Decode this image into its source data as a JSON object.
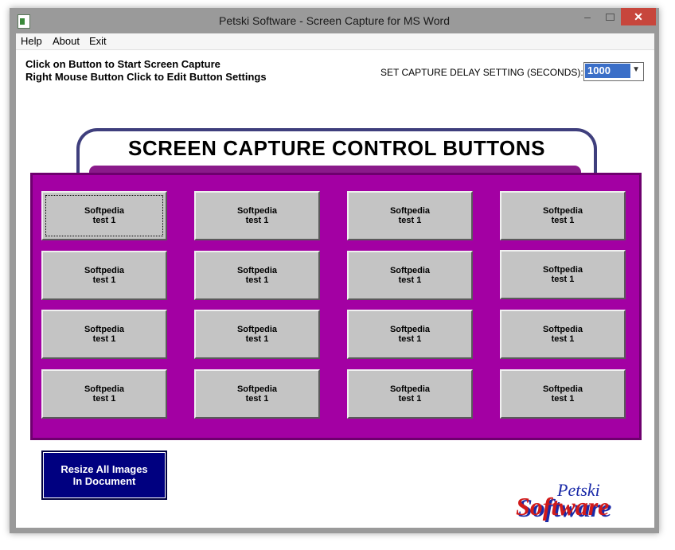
{
  "window": {
    "title": "Petski Software -  Screen Capture for MS Word",
    "close_glyph": "✕",
    "min_glyph": "–"
  },
  "menu": [
    {
      "label": "Help"
    },
    {
      "label": "About"
    },
    {
      "label": "Exit"
    }
  ],
  "instructions": {
    "line1": "Click on Button to Start Screen Capture",
    "line2": "Right Mouse Button Click to Edit Button Settings"
  },
  "delay": {
    "label": "SET CAPTURE DELAY SETTING (SECONDS):",
    "value": "1000"
  },
  "header": {
    "title": "SCREEN CAPTURE CONTROL BUTTONS"
  },
  "capture_buttons": [
    {
      "line1": "Softpedia",
      "line2": "test 1"
    },
    {
      "line1": "Softpedia",
      "line2": "test 1"
    },
    {
      "line1": "Softpedia",
      "line2": "test 1"
    },
    {
      "line1": "Softpedia",
      "line2": "test 1"
    },
    {
      "line1": "Softpedia",
      "line2": "test 1"
    },
    {
      "line1": "Softpedia",
      "line2": "test 1"
    },
    {
      "line1": "Softpedia",
      "line2": "test 1"
    },
    {
      "line1": "Softpedia",
      "line2": "test 1"
    },
    {
      "line1": "Softpedia",
      "line2": "test 1"
    },
    {
      "line1": "Softpedia",
      "line2": "test 1"
    },
    {
      "line1": "Softpedia",
      "line2": "test 1"
    },
    {
      "line1": "Softpedia",
      "line2": "test 1"
    },
    {
      "line1": "Softpedia",
      "line2": "test 1"
    },
    {
      "line1": "Softpedia",
      "line2": "test 1"
    },
    {
      "line1": "Softpedia",
      "line2": "test 1"
    },
    {
      "line1": "Softpedia",
      "line2": "test 1"
    }
  ],
  "resize_button": {
    "line1": "Resize All Images",
    "line2": "In Document"
  },
  "logo": {
    "line1": "Petski",
    "line2": "Software"
  },
  "colors": {
    "panel": "#a300a3",
    "resize_button": "#000080",
    "logo_red": "#d11a1a",
    "logo_blue": "#1a2aa8"
  }
}
